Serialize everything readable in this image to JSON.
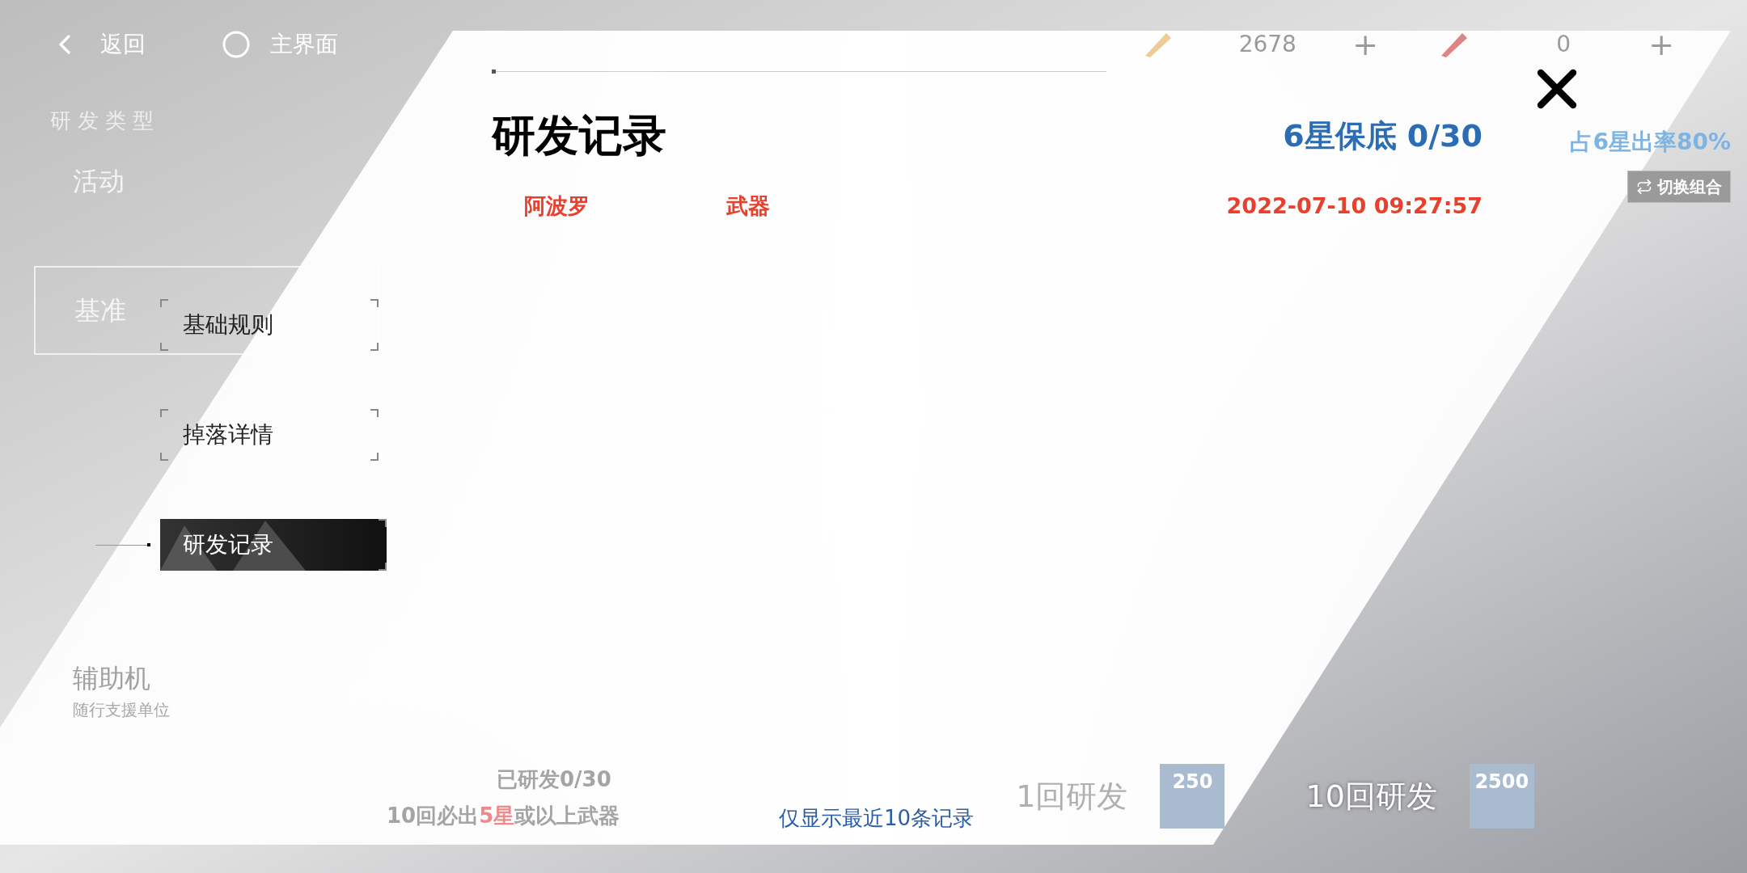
{
  "top_bar": {
    "back": "返回",
    "home": "主界面",
    "currencies": [
      {
        "amount": "2678",
        "add": "+"
      },
      {
        "amount": "0",
        "add": "+"
      }
    ]
  },
  "background": {
    "category_heading": "研发类型",
    "categories": [
      {
        "name": "活动",
        "selected": false
      },
      {
        "name": "基准",
        "selected": true
      },
      {
        "name": "辅助机",
        "subtitle": "随行支援单位",
        "selected": false
      }
    ],
    "rate": "占6星出率80%",
    "switch_button": "切换组合",
    "progress": "已研发0/30",
    "guarantee_note": [
      {
        "text": "10回必出",
        "highlight": false
      },
      {
        "text": "5星",
        "highlight": true
      },
      {
        "text": "或以上武器",
        "highlight": false
      }
    ],
    "pulls": [
      {
        "label": "1回研发",
        "cost": "250"
      },
      {
        "label": "10回研发",
        "cost": "2500"
      }
    ]
  },
  "dialog": {
    "tabs": [
      {
        "label": "基础规则",
        "selected": false
      },
      {
        "label": "掉落详情",
        "selected": false
      },
      {
        "label": "研发记录",
        "selected": true
      }
    ],
    "title": "研发记录",
    "pity": "6星保底 0/30",
    "records": [
      {
        "name": "阿波罗",
        "type": "武器",
        "time": "2022-07-10 09:27:57"
      }
    ],
    "footer": "仅显示最近10条记录"
  }
}
